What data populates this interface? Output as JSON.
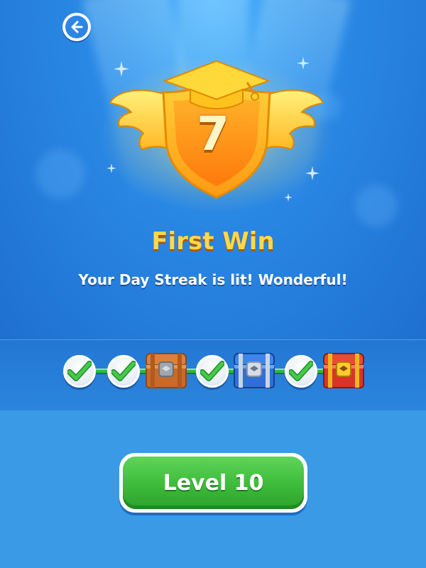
{
  "header": {
    "back_icon": "arrow-left-icon"
  },
  "badge": {
    "number": "7",
    "icon": "graduation-cap-shield-badge-icon",
    "colors": {
      "gold": "#ffcc2e",
      "orange": "#ff9a1a"
    }
  },
  "title": "First Win",
  "subtitle": "Your Day Streak is lit! Wonderful!",
  "streak": {
    "steps": [
      {
        "type": "check",
        "icon": "checkmark-icon",
        "completed": true
      },
      {
        "type": "check",
        "icon": "checkmark-icon",
        "completed": true
      },
      {
        "type": "chest",
        "icon": "bronze-chest-icon",
        "color": "#c86a2a"
      },
      {
        "type": "check",
        "icon": "checkmark-icon",
        "completed": true
      },
      {
        "type": "chest",
        "icon": "blue-chest-icon",
        "color": "#2f6fd8"
      },
      {
        "type": "check",
        "icon": "checkmark-icon",
        "completed": true
      },
      {
        "type": "chest",
        "icon": "red-chest-icon",
        "color": "#d8342a"
      }
    ]
  },
  "action": {
    "level_label": "Level 10",
    "color": "#3dbb3a"
  }
}
